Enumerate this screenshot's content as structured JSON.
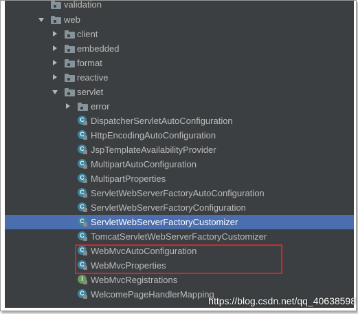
{
  "tree": {
    "validation": "validation",
    "web": "web",
    "client": "client",
    "embedded": "embedded",
    "format": "format",
    "reactive": "reactive",
    "servlet": "servlet",
    "error": "error",
    "classes": [
      "DispatcherServletAutoConfiguration",
      "HttpEncodingAutoConfiguration",
      "JspTemplateAvailabilityProvider",
      "MultipartAutoConfiguration",
      "MultipartProperties",
      "ServletWebServerFactoryAutoConfiguration",
      "ServletWebServerFactoryConfiguration",
      "ServletWebServerFactoryCustomizer",
      "TomcatServletWebServerFactoryCustomizer",
      "WebMvcAutoConfiguration",
      "WebMvcProperties",
      "WebMvcRegistrations",
      "WelcomePageHandlerMapping"
    ],
    "selected_item": "ServletWebServerFactoryCustomizer",
    "class_badge": "C",
    "interface_badge": "I"
  },
  "watermark": "https://blog.csdn.net/qq_40638598",
  "colors": {
    "panel_bg": "#3c3f41",
    "selection": "#4b6eaf",
    "highlight_box": "#d7262b",
    "text": "#bbbbbb"
  }
}
